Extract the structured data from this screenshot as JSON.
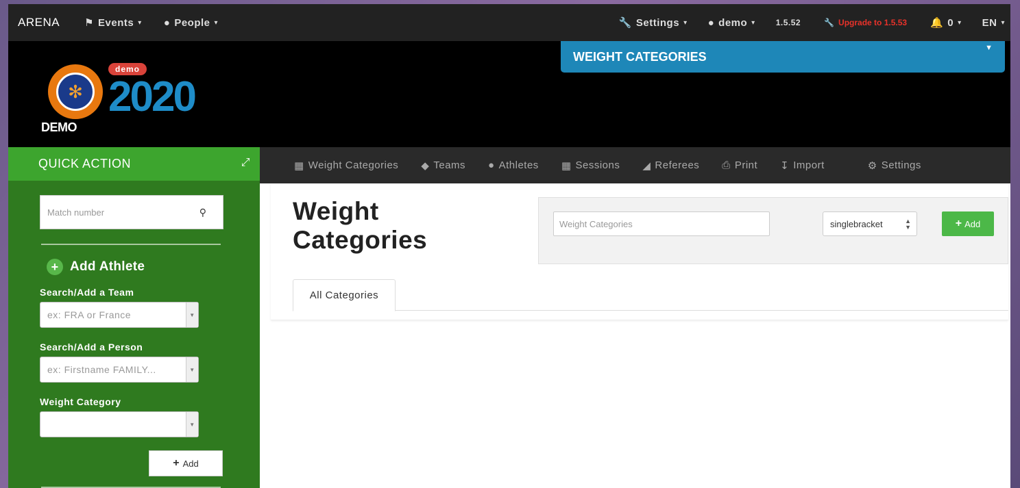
{
  "topnav": {
    "brand": "ARENA",
    "events": "Events",
    "people": "People",
    "settings": "Settings",
    "user": "demo",
    "version": "1.5.52",
    "upgrade": "Upgrade to 1.5.53",
    "notifications": "0",
    "language": "EN"
  },
  "header": {
    "badge": "demo",
    "year": "2020",
    "logo_text": "DEMO",
    "banner": "WEIGHT CATEGORIES"
  },
  "sidebar": {
    "title": "QUICK ACTION",
    "match_placeholder": "Match number",
    "add_athlete": "Add Athlete",
    "team_label": "Search/Add a Team",
    "team_placeholder": "ex: FRA or France",
    "person_label": "Search/Add a Person",
    "person_placeholder": "ex: Firstname FAMILY...",
    "weight_label": "Weight Category",
    "add_button": "Add"
  },
  "subnav": {
    "items": [
      "Weight Categories",
      "Teams",
      "Athletes",
      "Sessions",
      "Referees",
      "Print",
      "Import"
    ],
    "settings": "Settings"
  },
  "main": {
    "title_line1": "Weight",
    "title_line2": "Categories",
    "search_placeholder": "Weight Categories",
    "bracket_select": "singlebracket",
    "add_button": "Add",
    "tab_all": "All Categories"
  },
  "colors": {
    "accent_green": "#3da52e",
    "sidebar_green": "#2f7a1f",
    "banner_blue": "#1e87b8",
    "upgrade_red": "#e8322a"
  }
}
